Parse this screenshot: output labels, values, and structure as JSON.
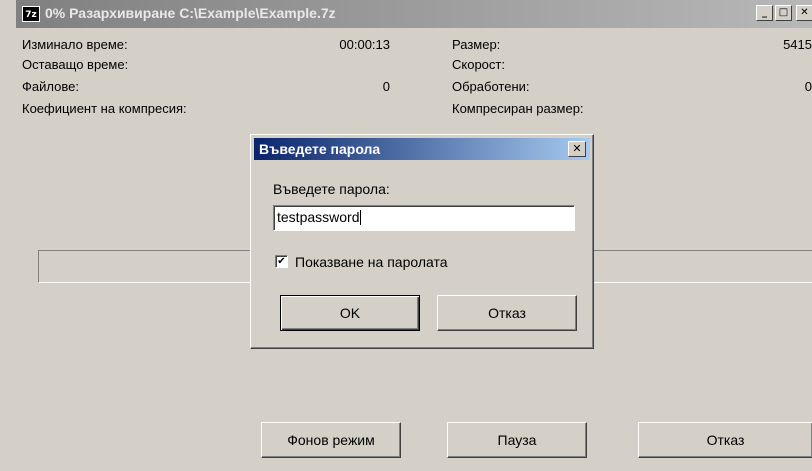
{
  "window": {
    "icon_text": "7z",
    "title": "0% Разархивиране C:\\Example\\Example.7z",
    "minimize_glyph": "_",
    "maximize_glyph": "□",
    "close_glyph": "✕"
  },
  "stats_left": [
    {
      "label": "Изминало време:",
      "value": "00:00:13"
    },
    {
      "label": "Оставащо време:",
      "value": ""
    },
    {
      "label": "Файлове:",
      "value": "0"
    },
    {
      "label": "Коефициент на компресия:",
      "value": ""
    }
  ],
  "stats_right": [
    {
      "label": "Размер:",
      "value": "5415"
    },
    {
      "label": "Скорост:",
      "value": ""
    },
    {
      "label": "Обработени:",
      "value": "0"
    },
    {
      "label": "Компресиран размер:",
      "value": ""
    }
  ],
  "progress": {
    "fraction": 0
  },
  "buttons": {
    "background": "Фонов режим",
    "pause": "Пауза",
    "cancel": "Отказ"
  },
  "dialog": {
    "title": "Въведете парола",
    "close_glyph": "✕",
    "prompt": "Въведете парола:",
    "password_value": "testpassword",
    "show_password_label": "Показване на паролата",
    "show_password_checked": true,
    "check_glyph": "✔",
    "ok_label": "OK",
    "cancel_label": "Отказ"
  }
}
